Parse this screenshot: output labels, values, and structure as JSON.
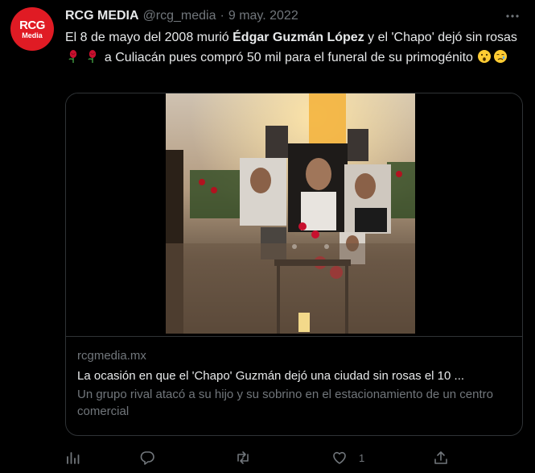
{
  "account": {
    "avatar_line1": "RCG",
    "avatar_line2": "Media",
    "name": "RCG MEDIA",
    "handle": "@rcg_media",
    "separator": "·",
    "date": "9 may. 2022"
  },
  "tweet": {
    "text_part1": "El 8 de mayo del 2008 murió ",
    "text_bold": "Édgar Guzmán López",
    "text_part2": " y el 'Chapo' dejó sin rosas ",
    "text_part3": " a Culiacán pues compró 50 mil para el funeral de su primogénito ",
    "emojis": [
      "rose",
      "rose",
      "astonished-face",
      "crying-face"
    ]
  },
  "card": {
    "domain": "rcgmedia.mx",
    "title": "La ocasión en que el 'Chapo' Guzmán dejó una ciudad sin rosas el 10 ...",
    "description": "Un grupo rival atacó a su hijo y su sobrino en el estacionamiento de un centro comercial"
  },
  "actions": {
    "analytics": "",
    "reply": "",
    "retweet": "",
    "like": "1",
    "share": ""
  },
  "icons": [
    "analytics-icon",
    "reply-icon",
    "retweet-icon",
    "like-icon",
    "share-icon",
    "more-icon"
  ],
  "colors": {
    "background": "#000000",
    "text": "#e7e9ea",
    "secondary": "#71767b",
    "border": "#2f3336",
    "avatar": "#e01b24"
  }
}
